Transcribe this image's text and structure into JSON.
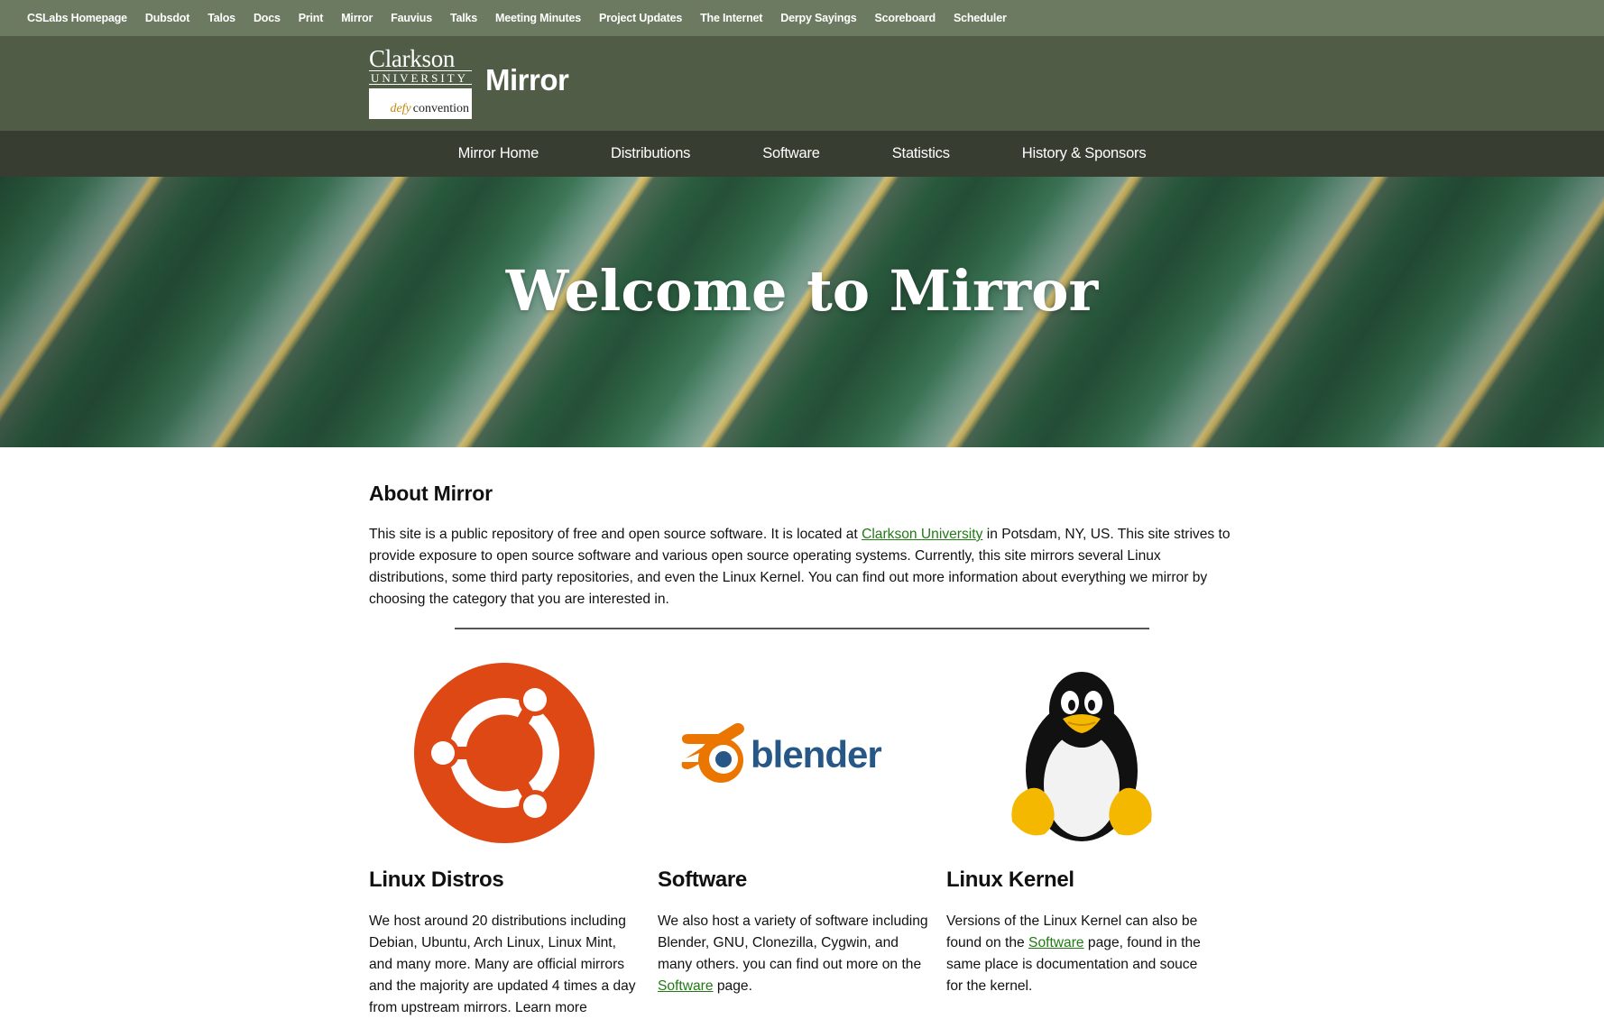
{
  "topbar": {
    "links": [
      "CSLabs Homepage",
      "Dubsdot",
      "Talos",
      "Docs",
      "Print",
      "Mirror",
      "Fauvius",
      "Talks",
      "Meeting Minutes",
      "Project Updates",
      "The Internet",
      "Derpy Sayings",
      "Scoreboard",
      "Scheduler"
    ]
  },
  "header": {
    "logo": {
      "name": "Clarkson",
      "university": "UNIVERSITY",
      "tagline_defy": "defy",
      "tagline_rest": "convention"
    },
    "title": "Mirror"
  },
  "nav": {
    "items": [
      "Mirror Home",
      "Distributions",
      "Software",
      "Statistics",
      "History & Sponsors"
    ]
  },
  "hero": {
    "heading": "Welcome to Mirror"
  },
  "about": {
    "title": "About Mirror",
    "text_before_link": "This site is a public repository of free and open source software. It is located at ",
    "link": "Clarkson University",
    "text_after_link": " in Potsdam, NY, US. This site strives to provide exposure to open source software and various open source operating systems. Currently, this site mirrors several Linux distributions, some third party repositories, and even the Linux Kernel. You can find out more information about everything we mirror by choosing the category that you are interested in."
  },
  "cards": [
    {
      "icon": "ubuntu-logo",
      "title": "Linux Distros",
      "text": "We host around 20 distributions including Debian, Ubuntu, Arch Linux, Linux Mint, and many more. Many are official mirrors and the majority are updated 4 times a day from upstream mirrors. Learn more"
    },
    {
      "icon": "blender-logo",
      "logo_text": "blender",
      "title": "Software",
      "text_before_link": "We also host a variety of software including Blender, GNU, Clonezilla, Cygwin, and many others. you can find out more on the ",
      "link": "Software",
      "text_after_link": " page."
    },
    {
      "icon": "tux-penguin-logo",
      "title": "Linux Kernel",
      "text_before_link": "Versions of the Linux Kernel can also be found on the ",
      "link": "Software",
      "text_after_link": " page, found in the same place is documentation and souce for the kernel."
    }
  ],
  "colors": {
    "topbar": "#6b7a60",
    "header": "#505c45",
    "nav": "#373e31",
    "link": "#217a14",
    "ubuntu": "#dd4814",
    "blender_orange": "#ea7600",
    "blender_blue": "#265787"
  }
}
